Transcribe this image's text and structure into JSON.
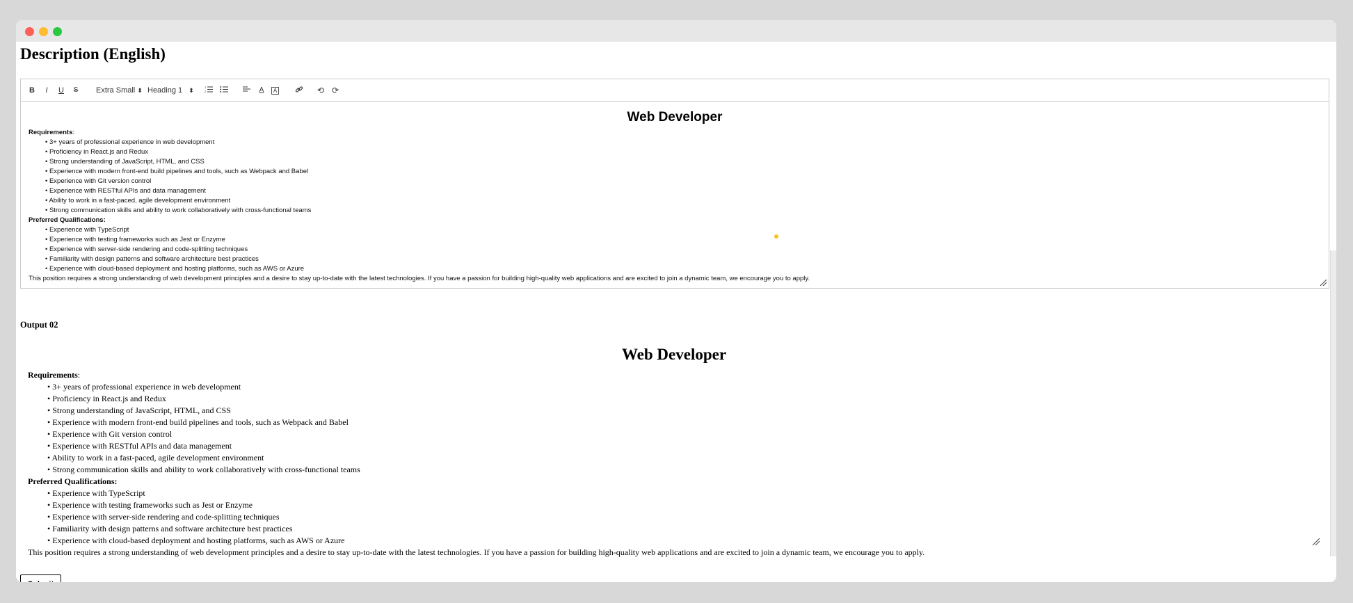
{
  "page": {
    "title": "Description (English)"
  },
  "toolbar": {
    "bold_icon": "B",
    "italic_icon": "I",
    "underline_icon": "U",
    "strike_icon": "S",
    "font_size": "Extra Small",
    "heading": "Heading 1",
    "select_arrow": "⬍",
    "ordered_list_icon": "ordered-list-icon",
    "bullet_list_icon": "bullet-list-icon",
    "align_icon": "align-left-icon",
    "text_color_icon": "A",
    "highlight_icon": "A",
    "link_icon": "link-icon",
    "undo_icon": "undo-icon",
    "redo_icon": "redo-icon"
  },
  "document": {
    "title": "Web Developer",
    "requirements_heading": "Requirements",
    "requirements_colon": ":",
    "requirements": [
      "3+ years of professional experience in web development",
      "Proficiency in React.js and Redux",
      "Strong understanding of JavaScript, HTML, and CSS",
      "Experience with modern front-end build pipelines and tools, such as Webpack and Babel",
      "Experience with Git version control",
      "Experience with RESTful APIs and data management",
      "Ability to work in a fast-paced, agile development environment",
      "Strong communication skills and ability to work collaboratively with cross-functional teams"
    ],
    "preferred_heading": "Preferred Qualifications:",
    "preferred": [
      "Experience with TypeScript",
      "Experience with testing frameworks such as Jest or Enzyme",
      "Experience with server-side rendering and code-splitting techniques",
      "Familiarity with design patterns and software architecture best practices",
      "Experience with cloud-based deployment and hosting platforms, such as AWS or Azure"
    ],
    "closing": "This position requires a strong understanding of web development principles and a desire to stay up-to-date with the latest technologies. If you have a passion for building high-quality web applications and are excited to join a dynamic team, we encourage you to apply."
  },
  "output": {
    "label": "Output 02"
  },
  "submit": {
    "label": "Submit"
  },
  "colors": {
    "cursor_dot": "#f5c518",
    "window_bg": "#ffffff",
    "page_bg": "#d8d8d8"
  }
}
